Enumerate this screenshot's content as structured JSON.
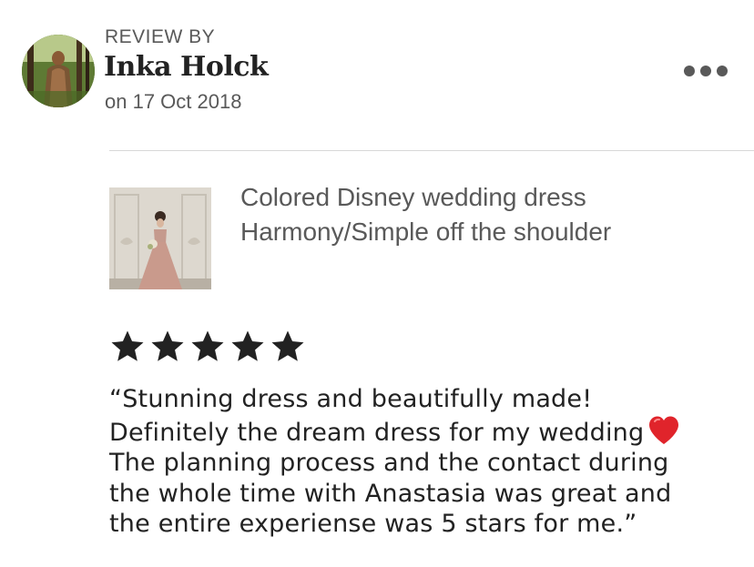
{
  "reviewer": {
    "header_label": "REVIEW BY",
    "name": "Inka Holck",
    "date": "on 17 Oct 2018",
    "avatar_icon": "reviewer-avatar-photo"
  },
  "menu": {
    "icon": "more-options-icon"
  },
  "product": {
    "title_line1": "Colored Disney wedding dress",
    "title_line2": "Harmony/Simple off the shoulder",
    "thumbnail_icon": "product-photo"
  },
  "rating": {
    "stars": 5,
    "max": 5,
    "star_color": "#222222"
  },
  "review": {
    "line1": "“Stunning dress and beautifully made!",
    "line2": "Definitely the dream dress for my wedding",
    "line3": "The planning process and the contact during",
    "line4": "the whole time with Anastasia was great and",
    "line5": "the entire experiense was 5 stars for me.”",
    "emoji_icon": "red-heart-icon",
    "emoji_color": "#e0242b"
  },
  "colors": {
    "text_primary": "#222222",
    "text_secondary": "#595959",
    "divider": "#d8d8d8"
  }
}
